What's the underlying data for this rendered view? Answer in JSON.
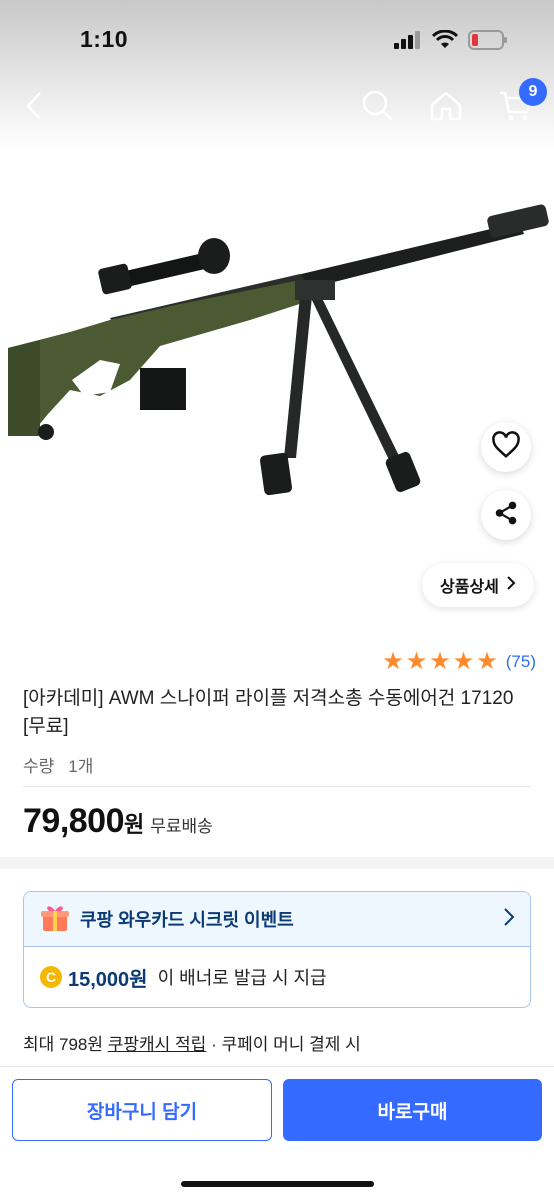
{
  "status_bar": {
    "time": "1:10"
  },
  "nav": {
    "cart_count": "9"
  },
  "product": {
    "detail_button_label": "상품상세",
    "rating_stars": 5,
    "review_count": "(75)",
    "title": "[아카데미] AWM 스나이퍼 라이플 저격소총 수동에어건 17120 [무료]",
    "qty_label": "수량",
    "qty_value": "1개",
    "price": "79,800",
    "price_unit": "원",
    "shipping": "무료배송"
  },
  "promo": {
    "title": "쿠팡 와우카드 시크릿 이벤트",
    "coin_symbol": "C",
    "amount": "15,000원",
    "description": "이 배너로 발급 시 지급"
  },
  "cash": {
    "prefix": "최대 798원",
    "link": "쿠팡캐시 적립",
    "suffix": "· 쿠페이 머니 결제 시"
  },
  "bottom": {
    "add_to_cart": "장바구니 담기",
    "buy_now": "바로구매"
  },
  "colors": {
    "accent": "#346aff",
    "star": "#ff8a2b",
    "review_link": "#2f6df6",
    "promo_border": "#a9c7ee",
    "promo_text": "#0b3a75"
  }
}
